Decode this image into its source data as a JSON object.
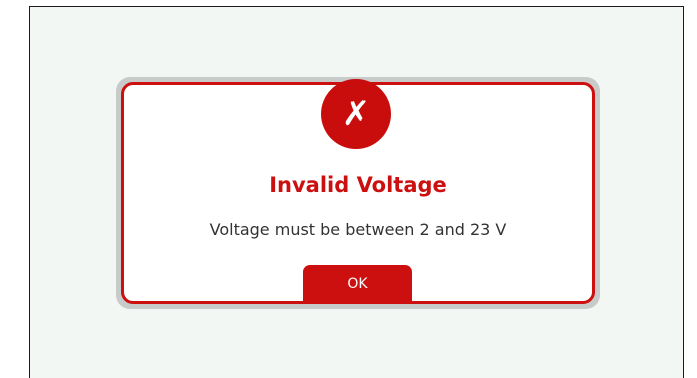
{
  "dialog": {
    "icon": "error-x-icon",
    "icon_glyph": "✗",
    "title": "Invalid Voltage",
    "message": "Voltage must be between 2 and 23 V",
    "ok_label": "OK"
  },
  "colors": {
    "accent": "#cc0f0f",
    "screen_background": "#f3f7f4",
    "dialog_background": "#ffffff",
    "message_text": "#333333"
  }
}
